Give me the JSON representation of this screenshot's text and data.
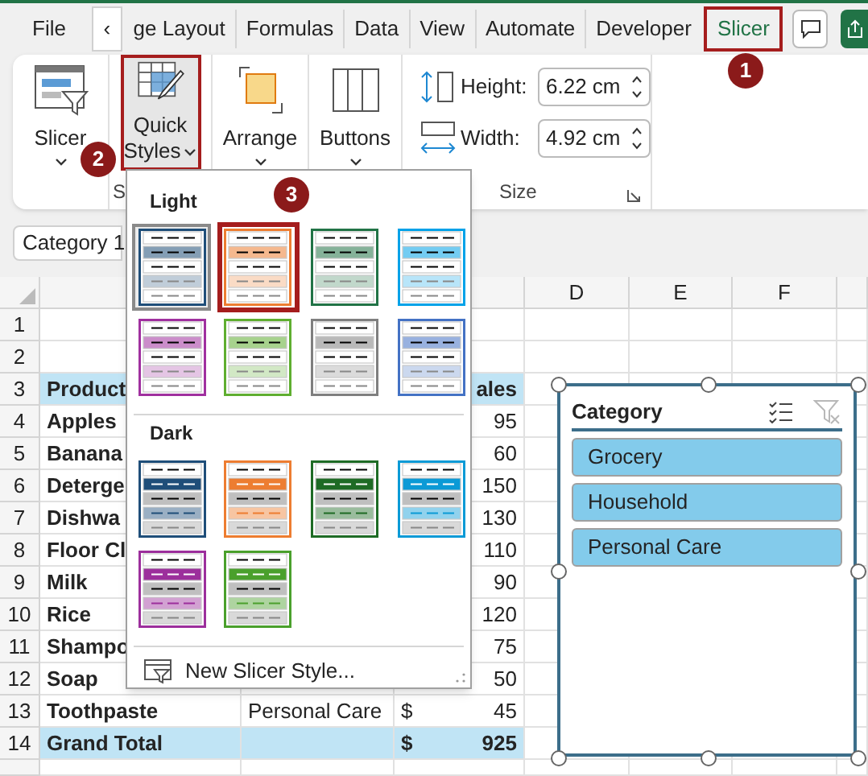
{
  "scroll_button": "‹",
  "tabs": [
    {
      "label": "File",
      "selected": false,
      "marked": false
    },
    {
      "label": "ge Layout",
      "selected": false,
      "marked": false
    },
    {
      "label": "Formulas",
      "selected": false,
      "marked": false
    },
    {
      "label": "Data",
      "selected": false,
      "marked": false
    },
    {
      "label": "View",
      "selected": false,
      "marked": false
    },
    {
      "label": "Automate",
      "selected": false,
      "marked": false
    },
    {
      "label": "Developer",
      "selected": false,
      "marked": false
    },
    {
      "label": "Slicer",
      "selected": true,
      "marked": true
    }
  ],
  "ribbon": {
    "slicer_button": {
      "label": "Slicer"
    },
    "quick_styles_button": {
      "label": "Quick",
      "label2": "Styles",
      "marked": true,
      "pressed": true
    },
    "arrange_button": {
      "label": "Arrange"
    },
    "buttons_button": {
      "label": "Buttons"
    },
    "height": {
      "label": "Height:",
      "value": "6.22 cm"
    },
    "width": {
      "label": "Width:",
      "value": "4.92 cm"
    },
    "groups": [
      {
        "label": "S"
      },
      {
        "label": "Size"
      }
    ]
  },
  "callouts": [
    "1",
    "2",
    "3"
  ],
  "name_box": {
    "value": "Category 1"
  },
  "columns": [
    "D",
    "E",
    "F"
  ],
  "rows": [
    {
      "number": "1",
      "kind": "empty"
    },
    {
      "number": "2",
      "kind": "empty"
    },
    {
      "number": "3",
      "kind": "header",
      "product": "Product",
      "sales": "ales"
    },
    {
      "number": "4",
      "kind": "data",
      "product": "Apples",
      "sales": "95"
    },
    {
      "number": "5",
      "kind": "data",
      "product": "Banana",
      "sales": "60"
    },
    {
      "number": "6",
      "kind": "data",
      "product": "Deterge",
      "sales": "150"
    },
    {
      "number": "7",
      "kind": "data",
      "product": "Dishwa",
      "sales": "130"
    },
    {
      "number": "8",
      "kind": "data",
      "product": "Floor Cl",
      "sales": "110"
    },
    {
      "number": "9",
      "kind": "data",
      "product": "Milk",
      "sales": "90"
    },
    {
      "number": "10",
      "kind": "data",
      "product": "Rice",
      "sales": "120"
    },
    {
      "number": "11",
      "kind": "data",
      "product": "Shampo",
      "sales": "75"
    },
    {
      "number": "12",
      "kind": "data",
      "product": "Soap",
      "sales": "50"
    },
    {
      "number": "13",
      "kind": "data",
      "product": "Toothpaste",
      "category": "Personal Care",
      "currency": "$",
      "sales": "45"
    },
    {
      "number": "14",
      "kind": "total",
      "product": "Grand Total",
      "currency": "$",
      "sales": "925"
    }
  ],
  "gallery": {
    "sections": [
      {
        "label": "Light",
        "kind": "light",
        "swatches": [
          {
            "color": "#1f4e79",
            "selected": true,
            "marked": false
          },
          {
            "color": "#ed7d31",
            "selected": false,
            "marked": true
          },
          {
            "color": "#217346",
            "selected": false,
            "marked": false
          },
          {
            "color": "#00a2e8",
            "selected": false,
            "marked": false
          },
          {
            "color": "#a0309f",
            "selected": false,
            "marked": false
          },
          {
            "color": "#5fae30",
            "selected": false,
            "marked": false
          },
          {
            "color": "#7f7f7f",
            "selected": false,
            "marked": false
          },
          {
            "color": "#4472c4",
            "selected": false,
            "marked": false
          }
        ]
      },
      {
        "label": "Dark",
        "kind": "dark",
        "swatches": [
          {
            "color": "#1f4e79",
            "selected": false,
            "marked": false
          },
          {
            "color": "#ed7d31",
            "selected": false,
            "marked": false
          },
          {
            "color": "#1e6b25",
            "selected": false,
            "marked": false
          },
          {
            "color": "#0b9ad6",
            "selected": false,
            "marked": false
          },
          {
            "color": "#9c2f9c",
            "selected": false,
            "marked": false
          },
          {
            "color": "#4aa02c",
            "selected": false,
            "marked": false
          }
        ]
      }
    ],
    "new_style": "New Slicer Style..."
  },
  "slicer": {
    "title": "Category",
    "items": [
      {
        "label": "Grocery",
        "selected": true
      },
      {
        "label": "Household",
        "selected": true
      },
      {
        "label": "Personal Care",
        "selected": true
      }
    ],
    "clear_filter_disabled": true
  }
}
